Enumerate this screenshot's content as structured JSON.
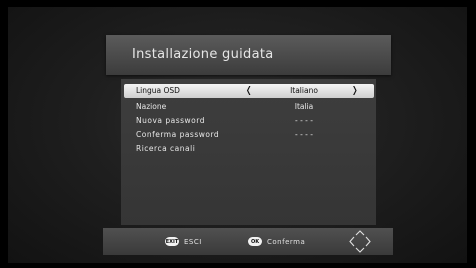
{
  "window": {
    "title": "Installazione guidata"
  },
  "menu": {
    "rows": [
      {
        "label": "Lingua OSD",
        "value": "Italiano",
        "selected": true
      },
      {
        "label": "Nazione",
        "value": "Italia"
      },
      {
        "label": "Nuova password",
        "value": "- - - -"
      },
      {
        "label": "Conferma password",
        "value": "- - - -"
      },
      {
        "label": "Ricerca canali",
        "value": ""
      }
    ],
    "arrow_left": "❬",
    "arrow_right": "❭"
  },
  "footer": {
    "exit_key": "EXIT",
    "exit_label": "ESCI",
    "ok_key": "OK",
    "ok_label": "Conferma",
    "nav_icon": "dpad-arrows-icon"
  },
  "colors": {
    "background": "#1f1f1f",
    "title_bar": "#4a4a4a",
    "panel": "#3a3a3a",
    "selected_row": "#e4e4e4",
    "text": "#e8e8e8"
  }
}
